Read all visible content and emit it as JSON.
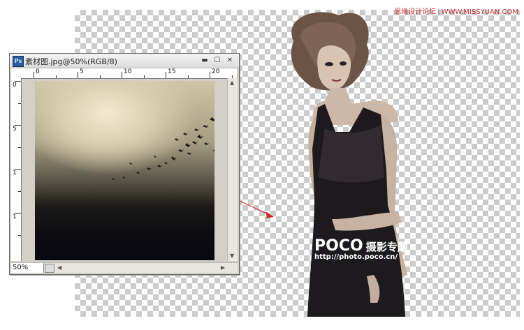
{
  "watermark": {
    "site_cn": "思缘设计论坛",
    "site_url": "WWW.MISSYUAN.COM"
  },
  "logo": {
    "brand": "POCO",
    "brand_cn": "摄影专题",
    "url": "http://photo.poco.cn/"
  },
  "document_window": {
    "app_icon": "Ps",
    "title": "素材图.jpg@50%(RGB/8)",
    "controls": {
      "minimize": "▬",
      "maximize": "☐",
      "close": "✕"
    },
    "ruler_top_labels": [
      "0",
      "5",
      "10",
      "15",
      "20"
    ],
    "ruler_left_labels": [
      "0",
      "5",
      "1",
      "1"
    ],
    "zoom_level": "50%"
  },
  "icons": {
    "app": "photoshop-document-icon",
    "minimize": "minimize-icon",
    "maximize": "maximize-icon",
    "close": "close-icon",
    "arrow": "drag-arrow-icon",
    "status": "status-menu-icon"
  },
  "colors": {
    "arrow": "#d42020",
    "watermark": "#d03030",
    "checker": "#cccccc"
  }
}
